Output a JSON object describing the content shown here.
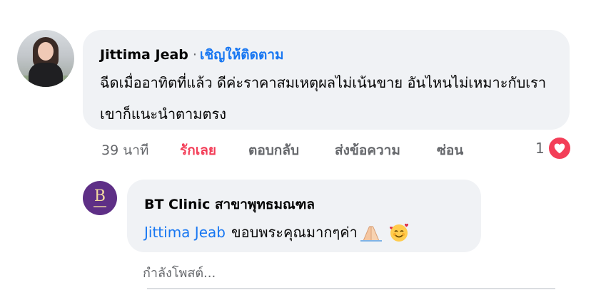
{
  "comment": {
    "author": "Jittima Jeab",
    "separator": "·",
    "follow_label": "เชิญให้ติดตาม",
    "text": "ฉีดเมื่ออาทิตที่แล้ว ดีค่ะราคาสมเหตุผลไม่เน้นขาย อันไหนไม่เหมาะกับเราเขาก็แนะนำตามตรง",
    "time": "39 นาที",
    "actions": {
      "love": "รักเลย",
      "reply": "ตอบกลับ",
      "send": "ส่งข้อความ",
      "hide": "ซ่อน"
    },
    "reaction_count": "1",
    "reaction_icon": "heart-icon"
  },
  "reply": {
    "author": "BT Clinic สาขาพุทธมณฑล",
    "mention": "Jittima Jeab",
    "text": "ขอบพระคุณมากๆค่า",
    "emojis": [
      "folded-hands-icon",
      "smiling-face-with-hearts-icon"
    ],
    "avatar_text": "B"
  },
  "status": {
    "posting": "กำลังโพสต์..."
  },
  "colors": {
    "link": "#1877f2",
    "love": "#f33e58",
    "muted": "#65676b",
    "bubble": "#f0f2f5"
  }
}
